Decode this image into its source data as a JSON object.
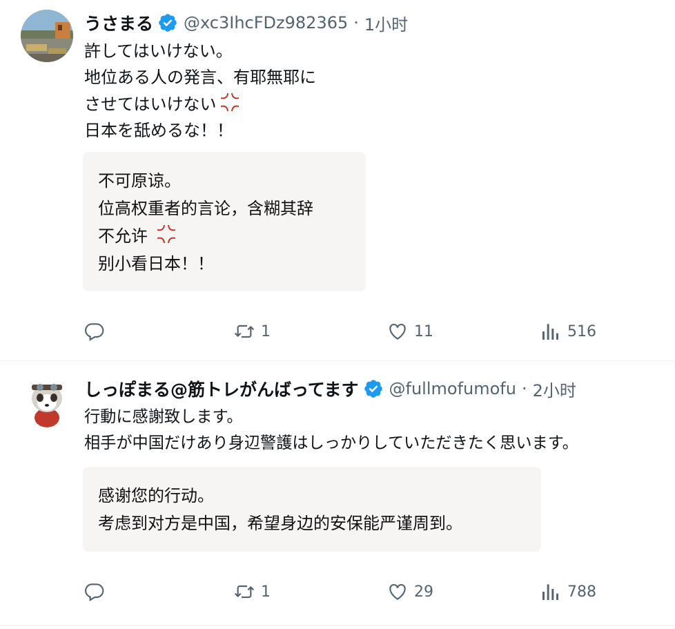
{
  "tweets": [
    {
      "display_name": "うさまる",
      "handle": "@xc3IhcFDz982365",
      "separator": "·",
      "time": "1小时",
      "body": [
        "許してはいけない。",
        "地位ある人の発言、有耶無耶に",
        "させてはいけない",
        "日本を舐めるな！！"
      ],
      "translation": [
        "不可原谅。",
        "位高权重者的言论，含糊其辞",
        "不允许",
        "别小看日本！！"
      ],
      "counts": {
        "replies": "",
        "retweets": "1",
        "likes": "11",
        "views": "516"
      }
    },
    {
      "display_name": "しっぽまる@筋トレがんばってます",
      "handle": "@fullmofumofu",
      "separator": "·",
      "time": "2小时",
      "body": [
        "行動に感謝致します。",
        "相手が中国だけあり身辺警護はしっかりしていただきたく思います。"
      ],
      "translation": [
        "感谢您的行动。",
        "考虑到对方是中国，希望身边的安保能严谨周到。"
      ],
      "counts": {
        "replies": "",
        "retweets": "1",
        "likes": "29",
        "views": "788"
      }
    }
  ],
  "icons": {
    "verified": "verified-badge-icon",
    "anger": "anger-symbol-icon",
    "reply": "reply-icon",
    "retweet": "retweet-icon",
    "like": "heart-icon",
    "views": "views-icon"
  },
  "colors": {
    "verified": "#1d9bf0",
    "anger": "#c0392b",
    "muted": "#536471",
    "translation_bg": "#f7f4f4"
  }
}
